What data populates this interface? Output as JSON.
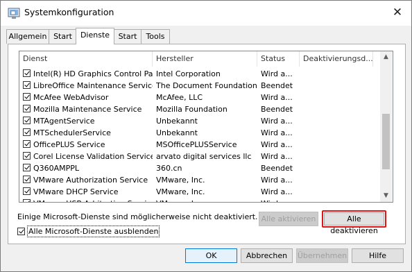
{
  "window": {
    "title": "Systemkonfiguration",
    "close_glyph": "✕"
  },
  "tabs": [
    {
      "label": "Allgemein"
    },
    {
      "label": "Start"
    },
    {
      "label": "Dienste",
      "active": true
    },
    {
      "label": "Start"
    },
    {
      "label": "Tools"
    }
  ],
  "columns": {
    "dienst": "Dienst",
    "hersteller": "Hersteller",
    "status": "Status",
    "deakt": "Deaktivierungsd..."
  },
  "services": [
    {
      "name": "Intel(R) HD Graphics Control Pa...",
      "vendor": "Intel Corporation",
      "status": "Wird a...",
      "checked": true
    },
    {
      "name": "LibreOffice Maintenance Service",
      "vendor": "The Document Foundation",
      "status": "Beendet",
      "checked": true
    },
    {
      "name": "McAfee WebAdvisor",
      "vendor": "McAfee, LLC",
      "status": "Wird a...",
      "checked": true
    },
    {
      "name": "Mozilla Maintenance Service",
      "vendor": "Mozilla Foundation",
      "status": "Beendet",
      "checked": true
    },
    {
      "name": "MTAgentService",
      "vendor": "Unbekannt",
      "status": "Wird a...",
      "checked": true
    },
    {
      "name": "MTSchedulerService",
      "vendor": "Unbekannt",
      "status": "Wird a...",
      "checked": true
    },
    {
      "name": "OfficePLUS Service",
      "vendor": "MSOfficePLUSService",
      "status": "Wird a...",
      "checked": true
    },
    {
      "name": "Corel License Validation Service ...",
      "vendor": "arvato digital services llc",
      "status": "Wird a...",
      "checked": true
    },
    {
      "name": "Q360AMPPL",
      "vendor": "360.cn",
      "status": "Beendet",
      "checked": true
    },
    {
      "name": "VMware Authorization Service",
      "vendor": "VMware, Inc.",
      "status": "Wird a...",
      "checked": true
    },
    {
      "name": "VMware DHCP Service",
      "vendor": "VMware, Inc.",
      "status": "Wird a...",
      "checked": true
    },
    {
      "name": "VMware USB Arbitration Service",
      "vendor": "VMware, Inc.",
      "status": "Wird a...",
      "checked": true
    }
  ],
  "note": "Einige Microsoft-Dienste sind möglicherweise nicht deaktiviert.",
  "buttons": {
    "enable_all": "Alle aktivieren",
    "disable_all": "Alle deaktivieren",
    "ok": "OK",
    "cancel": "Abbrechen",
    "apply": "Übernehmen",
    "help": "Hilfe"
  },
  "hide_ms": {
    "label": "Alle Microsoft-Dienste ausblenden",
    "checked": true
  },
  "colors": {
    "highlight": "#e01515",
    "default_button_border": "#0078d7"
  }
}
